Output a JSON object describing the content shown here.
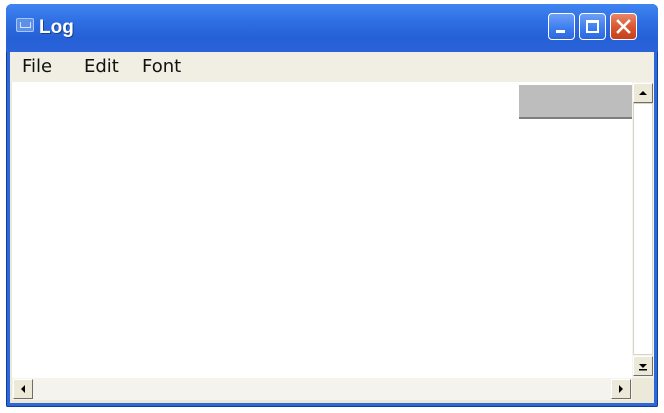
{
  "window": {
    "title": "Log"
  },
  "menu": {
    "file": "File",
    "edit": "Edit",
    "font": "Font"
  },
  "icons": {
    "app": "app-window-icon",
    "minimize": "minimize-icon",
    "maximize": "maximize-icon",
    "close": "close-icon",
    "scroll_up": "arrow-up-icon",
    "scroll_down": "arrow-down-icon",
    "scroll_left": "arrow-left-icon",
    "scroll_right": "arrow-right-icon"
  },
  "colors": {
    "titlebar": "#2f6fe3",
    "close_button": "#d9542c",
    "menubar": "#f1efe3",
    "text_area": "#ffffff"
  }
}
